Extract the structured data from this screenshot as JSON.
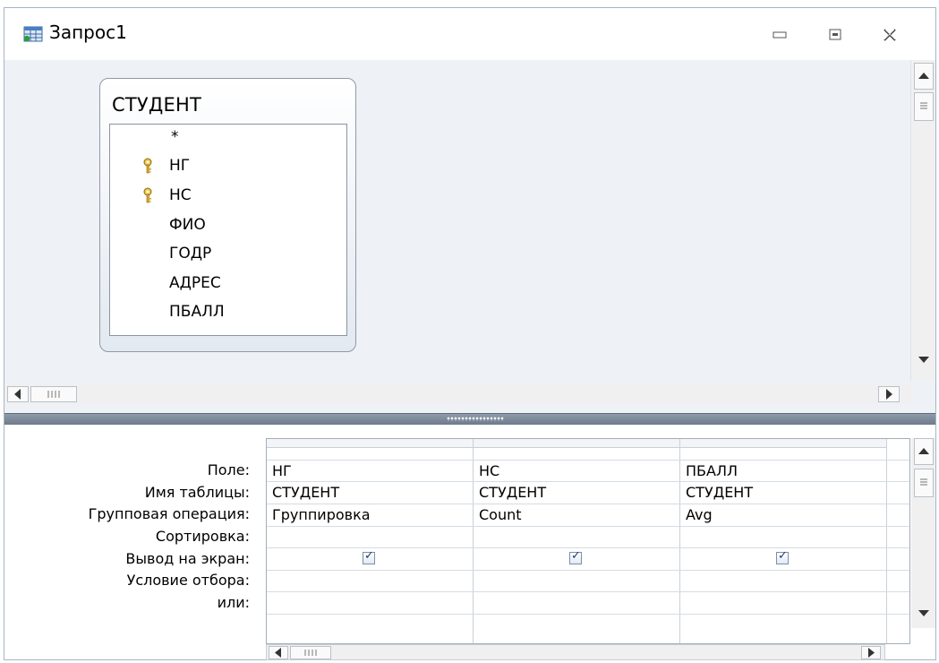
{
  "window": {
    "title": "Запрос1"
  },
  "table": {
    "name": "СТУДЕНТ",
    "fields": [
      {
        "name": "*",
        "key": false
      },
      {
        "name": "НГ",
        "key": true
      },
      {
        "name": "НС",
        "key": true
      },
      {
        "name": "ФИО",
        "key": false
      },
      {
        "name": "ГОДР",
        "key": false
      },
      {
        "name": "АДРЕС",
        "key": false
      },
      {
        "name": "ПБАЛЛ",
        "key": false
      }
    ]
  },
  "grid": {
    "row_labels": [
      "Поле:",
      "Имя таблицы:",
      "Групповая операция:",
      "Сортировка:",
      "Вывод на экран:",
      "Условие отбора:",
      "или:"
    ],
    "columns": [
      {
        "field": "НГ",
        "table": "СТУДЕНТ",
        "group": "Группировка",
        "sort": "",
        "show": true,
        "criteria": "",
        "or": ""
      },
      {
        "field": "НС",
        "table": "СТУДЕНТ",
        "group": "Count",
        "sort": "",
        "show": true,
        "criteria": "",
        "or": ""
      },
      {
        "field": "ПБАЛЛ",
        "table": "СТУДЕНТ",
        "group": "Avg",
        "sort": "",
        "show": true,
        "criteria": "",
        "or": ""
      }
    ]
  },
  "icons": {
    "window_icon": "query-icon",
    "key_icon": "primary-key-icon",
    "minimize": "minimize-icon",
    "restore": "restore-icon",
    "close": "close-icon"
  }
}
